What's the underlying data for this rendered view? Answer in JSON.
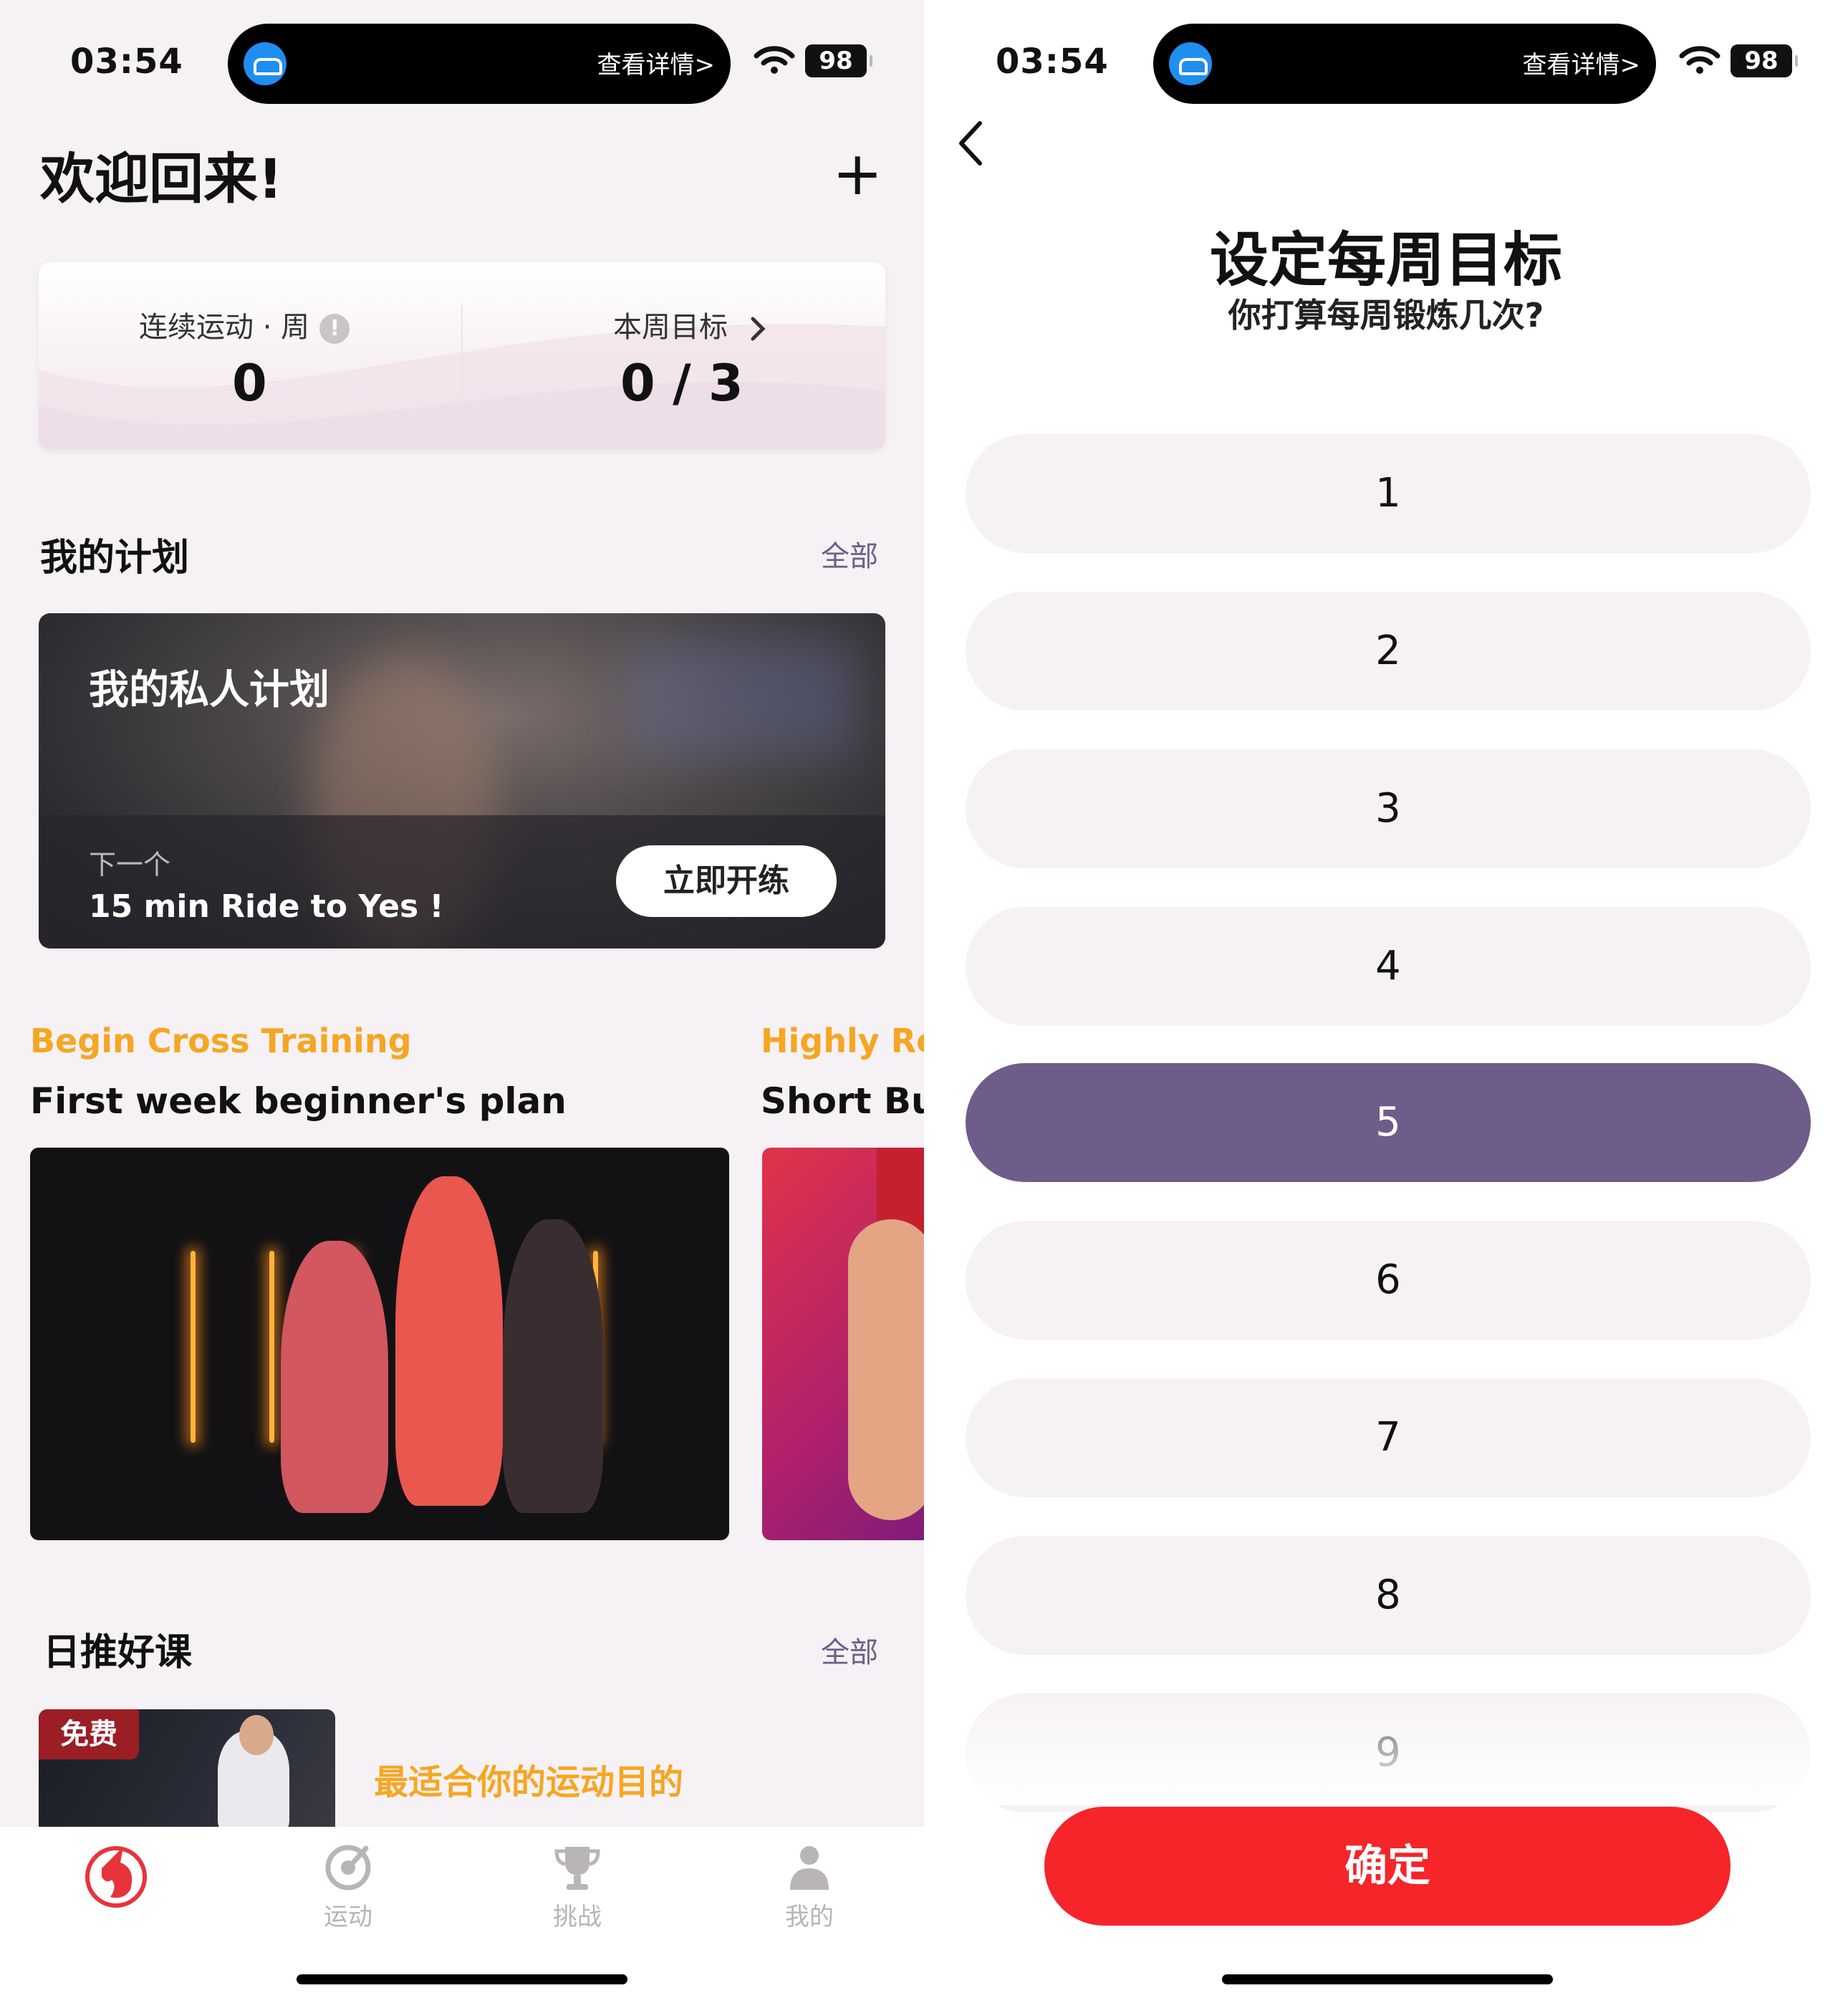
{
  "status_bar": {
    "time": "03:54",
    "island_text": "查看详情>",
    "battery": "98"
  },
  "home": {
    "welcome": "欢迎回来!",
    "add_icon": "plus-icon",
    "stats": {
      "streak_label": "连续运动 · 周",
      "streak_value": "0",
      "goal_label": "本周目标",
      "goal_value": "0 / 3"
    },
    "my_plans": {
      "title": "我的计划",
      "see_all": "全部",
      "card_title": "我的私人计划",
      "next_label": "下一个",
      "next_name": "15 min Ride to Yes !",
      "start_button": "立即开练"
    },
    "promos": [
      {
        "kicker": "Begin Cross Training",
        "title": "First week beginner's plan"
      },
      {
        "kicker": "Highly Rec",
        "title": "Short Bu"
      }
    ],
    "daily": {
      "title": "日推好课",
      "see_all": "全部",
      "badge": "免费",
      "tagline": "最适合你的运动目的"
    },
    "tabs": [
      {
        "label": "",
        "icon": "unicorn-logo-icon"
      },
      {
        "label": "运动",
        "icon": "workout-icon"
      },
      {
        "label": "挑战",
        "icon": "trophy-icon"
      },
      {
        "label": "我的",
        "icon": "profile-icon"
      }
    ]
  },
  "goal_screen": {
    "title": "设定每周目标",
    "subtitle": "你打算每周锻炼几次?",
    "options": [
      "1",
      "2",
      "3",
      "4",
      "5",
      "6",
      "7",
      "8",
      "9"
    ],
    "selected": "5",
    "confirm": "确定"
  },
  "colors": {
    "accent_red": "#f5252a",
    "selected_purple": "#6e5c8a",
    "promo_orange": "#f5a623",
    "link_purple": "#6c5e87"
  }
}
